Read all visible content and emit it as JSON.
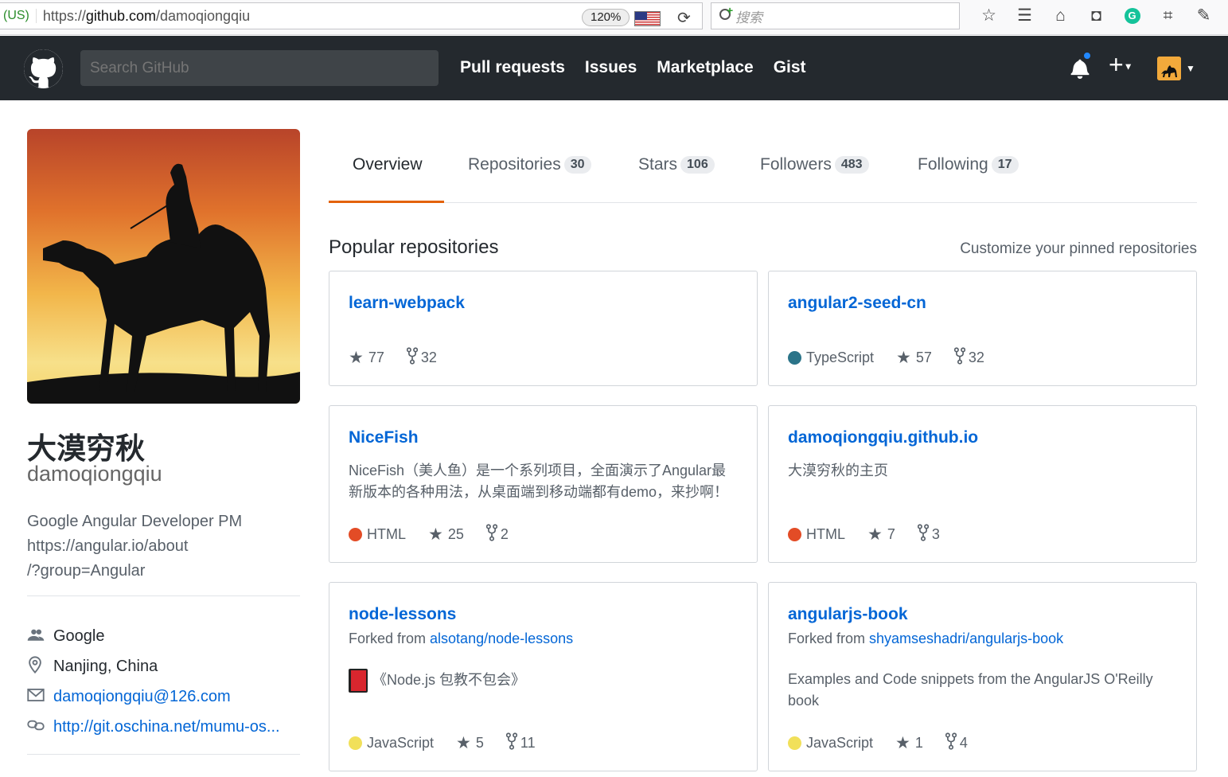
{
  "browser": {
    "secure_label": "(US)",
    "url_prefix": "https://",
    "url_host": "github.com",
    "url_path": "/damoqiongqiu",
    "zoom": "120%",
    "search_placeholder": "搜索"
  },
  "header": {
    "search_placeholder": "Search GitHub",
    "nav": [
      "Pull requests",
      "Issues",
      "Marketplace",
      "Gist"
    ]
  },
  "profile": {
    "fullname": "大漠穷秋",
    "username": "damoqiongqiu",
    "bio_lines": [
      "Google Angular Developer PM",
      "https://angular.io/about",
      "/?group=Angular"
    ],
    "company": "Google",
    "location": "Nanjing, China",
    "email": "damoqiongqiu@126.com",
    "website": "http://git.oschina.net/mumu-os..."
  },
  "tabs": [
    {
      "label": "Overview",
      "count": ""
    },
    {
      "label": "Repositories",
      "count": "30"
    },
    {
      "label": "Stars",
      "count": "106"
    },
    {
      "label": "Followers",
      "count": "483"
    },
    {
      "label": "Following",
      "count": "17"
    }
  ],
  "popular": {
    "title": "Popular repositories",
    "customize": "Customize your pinned repositories"
  },
  "repos": [
    {
      "name": "learn-webpack",
      "language": "",
      "lang_color": "",
      "stars": "77",
      "forks": "32"
    },
    {
      "name": "angular2-seed-cn",
      "language": "TypeScript",
      "lang_color": "#2b7489",
      "stars": "57",
      "forks": "32"
    },
    {
      "name": "NiceFish",
      "desc_lines": [
        "NiceFish（美人鱼）是一个系列项目，全面演示了Angular最",
        "新版本的各种用法，从桌面端到移动端都有demo，来抄啊！"
      ],
      "language": "HTML",
      "lang_color": "#e34c26",
      "stars": "25",
      "forks": "2"
    },
    {
      "name": "damoqiongqiu.github.io",
      "desc_lines": [
        "大漠穷秋的主页"
      ],
      "language": "HTML",
      "lang_color": "#e34c26",
      "stars": "7",
      "forks": "3"
    },
    {
      "name": "node-lessons",
      "forked_label": "Forked from ",
      "forked_from": "alsotang/node-lessons",
      "desc_lines": [
        "《Node.js 包教不包会》"
      ],
      "language": "JavaScript",
      "lang_color": "#f1e05a",
      "stars": "5",
      "forks": "11"
    },
    {
      "name": "angularjs-book",
      "forked_label": "Forked from ",
      "forked_from": "shyamseshadri/angularjs-book",
      "desc_lines": [
        "Examples and Code snippets from the AngularJS O'Reilly",
        "book"
      ],
      "language": "JavaScript",
      "lang_color": "#f1e05a",
      "stars": "1",
      "forks": "4"
    }
  ],
  "icons": {
    "star": "★",
    "company": "people-icon",
    "location": "location-icon",
    "email": "mail-icon",
    "link": "link-icon"
  }
}
